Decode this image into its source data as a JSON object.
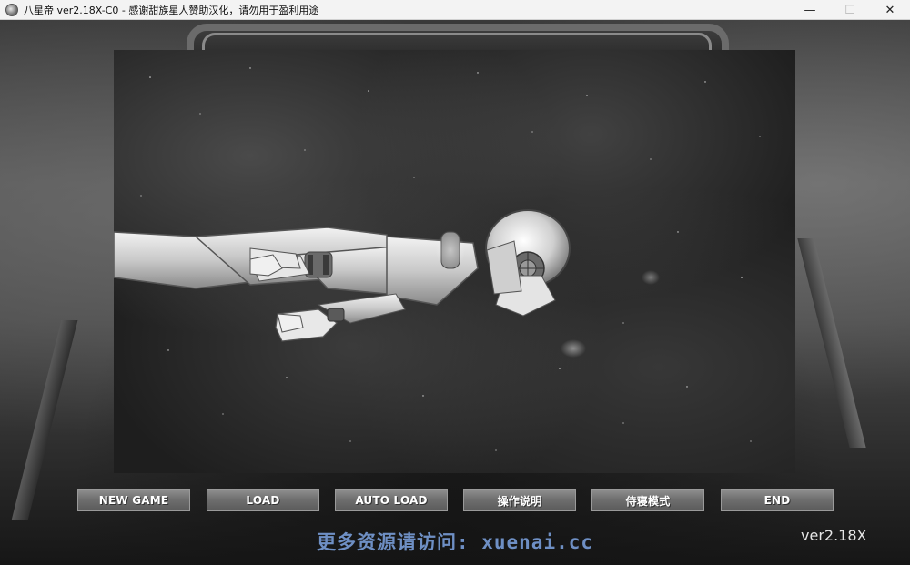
{
  "window": {
    "title": "八星帝 ver2.18X-C0 - 感谢甜族星人赞助汉化，请勿用于盈利用途",
    "icon": "app-icon",
    "controls": {
      "minimize": "—",
      "maximize": "☐",
      "close": "✕"
    }
  },
  "menu": {
    "buttons": [
      {
        "id": "new-game",
        "label": "NEW GAME"
      },
      {
        "id": "load",
        "label": "LOAD"
      },
      {
        "id": "auto-load",
        "label": "AUTO LOAD"
      },
      {
        "id": "instructions",
        "label": "操作说明"
      },
      {
        "id": "servant-mode",
        "label": "侍寝模式"
      },
      {
        "id": "end",
        "label": "END"
      }
    ]
  },
  "watermark": "更多资源请访问: xuenai.cc",
  "version": "ver2.18X",
  "colors": {
    "button_text": "#ffffff",
    "watermark": "#6e8fc4",
    "version_text": "#e6e6e6"
  }
}
